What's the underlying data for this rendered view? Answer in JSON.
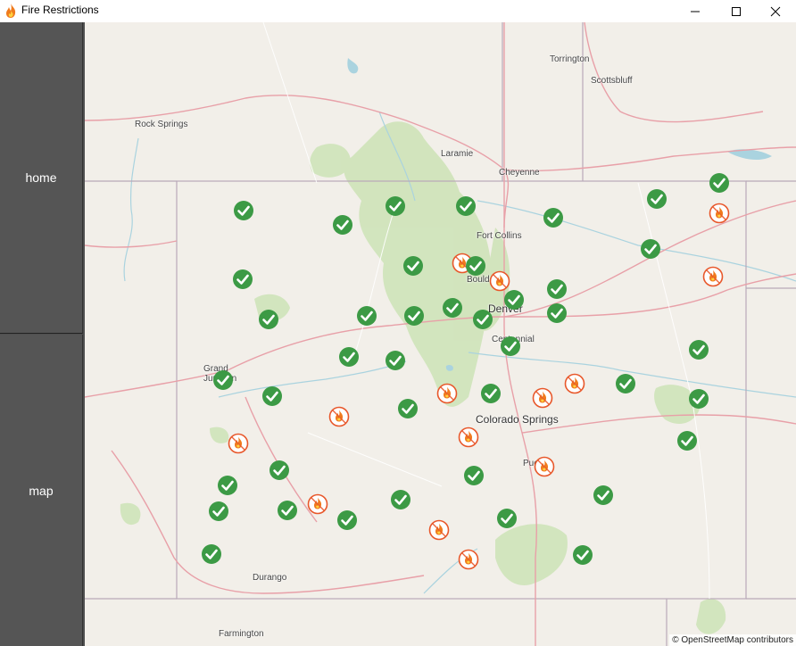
{
  "window": {
    "title": "Fire Restrictions",
    "icon": "flame-icon"
  },
  "nav": {
    "home_label": "home",
    "map_label": "map"
  },
  "map": {
    "attribution": "© OpenStreetMap contributors",
    "places": [
      "Torrington",
      "Scottsbluff",
      "Rock Springs",
      "Laramie",
      "Cheyenne",
      "Fort Collins",
      "Boulder",
      "Denver",
      "Centennial",
      "Grand Junction",
      "Colorado Springs",
      "Pueblo",
      "Durango",
      "Farmington"
    ],
    "markers": [
      {
        "status": "clear"
      },
      {
        "status": "clear"
      },
      {
        "status": "clear"
      },
      {
        "status": "clear"
      },
      {
        "status": "clear"
      },
      {
        "status": "clear"
      },
      {
        "status": "clear"
      },
      {
        "status": "restricted"
      },
      {
        "status": "clear"
      },
      {
        "status": "clear"
      },
      {
        "status": "clear"
      },
      {
        "status": "clear"
      },
      {
        "status": "clear"
      },
      {
        "status": "clear"
      },
      {
        "status": "restricted"
      },
      {
        "status": "clear"
      },
      {
        "status": "restricted"
      },
      {
        "status": "clear"
      },
      {
        "status": "clear"
      },
      {
        "status": "clear"
      },
      {
        "status": "clear"
      },
      {
        "status": "clear"
      },
      {
        "status": "clear"
      },
      {
        "status": "restricted"
      },
      {
        "status": "clear"
      },
      {
        "status": "clear"
      },
      {
        "status": "clear"
      },
      {
        "status": "restricted"
      },
      {
        "status": "clear"
      },
      {
        "status": "restricted"
      },
      {
        "status": "restricted"
      },
      {
        "status": "clear"
      },
      {
        "status": "clear"
      },
      {
        "status": "clear"
      },
      {
        "status": "clear"
      },
      {
        "status": "restricted"
      },
      {
        "status": "clear"
      },
      {
        "status": "restricted"
      },
      {
        "status": "restricted"
      },
      {
        "status": "clear"
      },
      {
        "status": "clear"
      },
      {
        "status": "clear"
      },
      {
        "status": "clear"
      },
      {
        "status": "restricted"
      },
      {
        "status": "clear"
      },
      {
        "status": "clear"
      },
      {
        "status": "clear"
      },
      {
        "status": "restricted"
      },
      {
        "status": "clear"
      },
      {
        "status": "clear"
      },
      {
        "status": "restricted"
      },
      {
        "status": "clear"
      },
      {
        "status": "restricted"
      },
      {
        "status": "clear"
      },
      {
        "status": "clear"
      }
    ]
  },
  "colors": {
    "clear": "#3c9a45",
    "restricted": "#e8572a",
    "sidebar": "#555555"
  }
}
